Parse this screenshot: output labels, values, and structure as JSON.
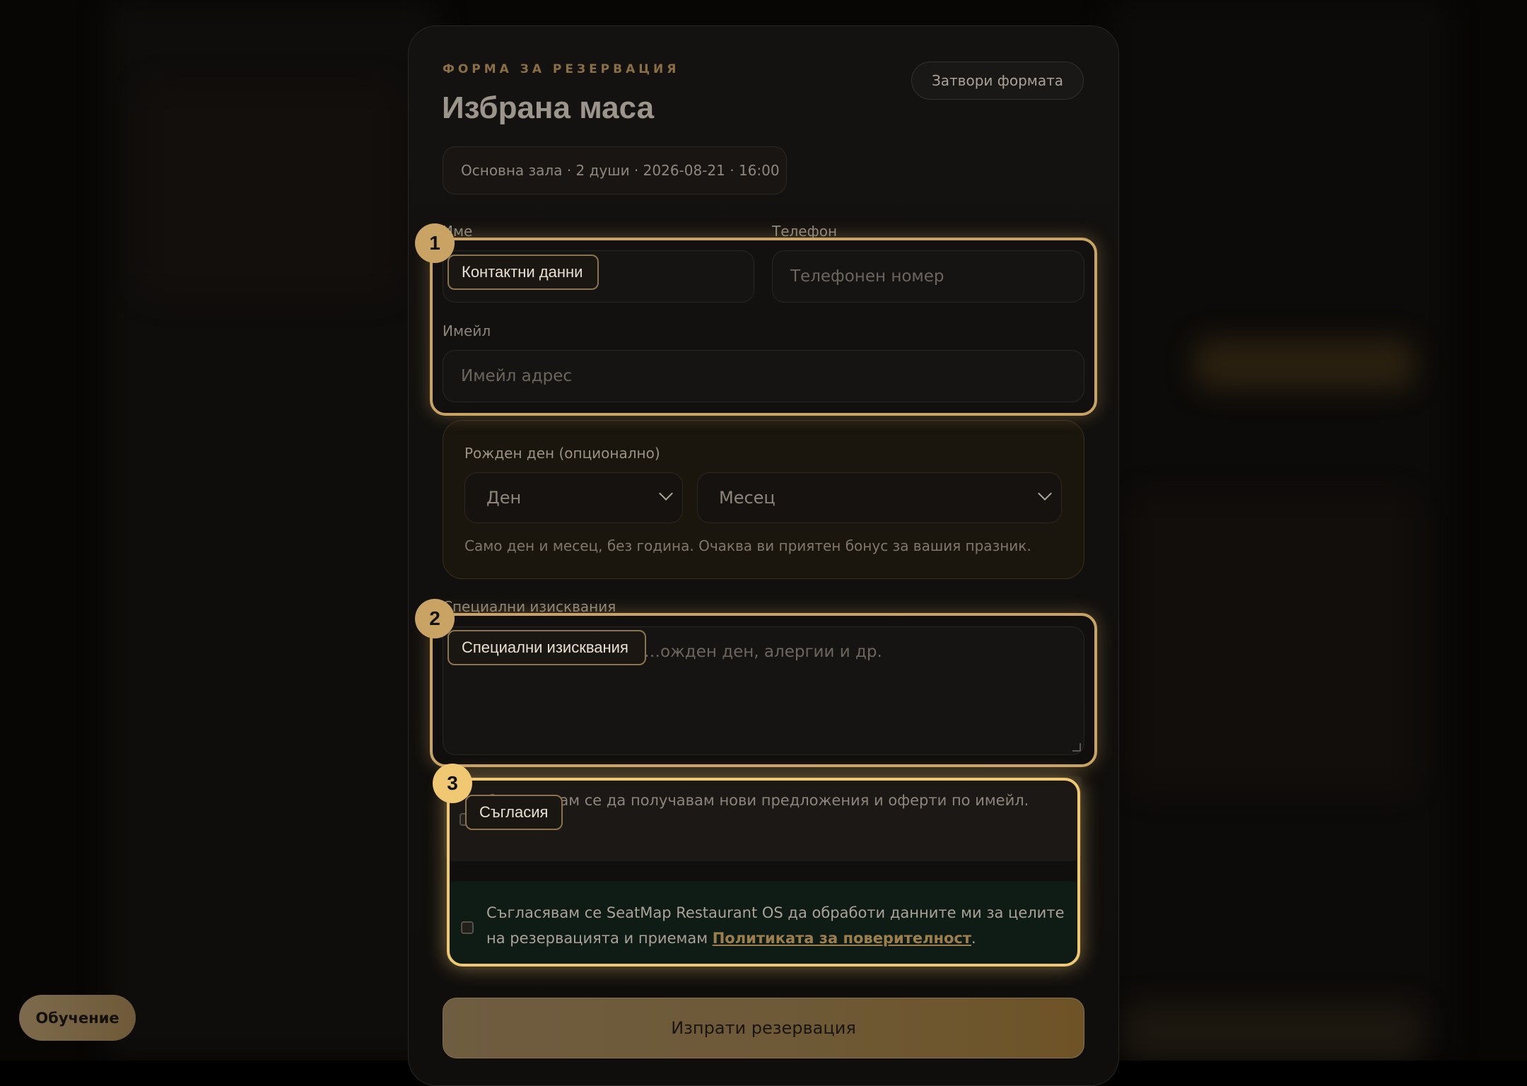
{
  "form": {
    "eyebrow": "ФОРМА ЗА РЕЗЕРВАЦИЯ",
    "title": "Избрана маса",
    "close_label": "Затвори формата",
    "summary": "Основна зала · 2 души · 2026-08-21 · 16:00",
    "name_label": "Име",
    "phone_label": "Телефон",
    "phone_placeholder": "Телефонен номер",
    "email_label": "Имейл",
    "email_placeholder": "Имейл адрес",
    "birthday": {
      "label": "Рожден ден (опционално)",
      "day_placeholder": "Ден",
      "month_placeholder": "Месец",
      "hint": "Само ден и месец, без година. Очаква ви приятен бонус за вашия празник."
    },
    "special_label": "Специални изисквания",
    "special_placeholder": "…ожден ден, алергии и др.",
    "consent_marketing": "Съгласявам се да получавам нови предложения и оферти по имейл.",
    "consent_privacy_text": "Съгласявам се SeatMap Restaurant OS да обработи данните ми за целите на резервацията и приемам ",
    "consent_privacy_link": "Политиката за поверителност",
    "consent_privacy_end": ".",
    "submit_label": "Изпрати резервация"
  },
  "tour": {
    "steps": [
      {
        "number": "1",
        "label": "Контактни данни"
      },
      {
        "number": "2",
        "label": "Специални изисквания"
      },
      {
        "number": "3",
        "label": "Съгласия"
      }
    ],
    "accent": "#c9a363",
    "active_accent": "#f0c772"
  },
  "tutorial_label": "Обучение"
}
